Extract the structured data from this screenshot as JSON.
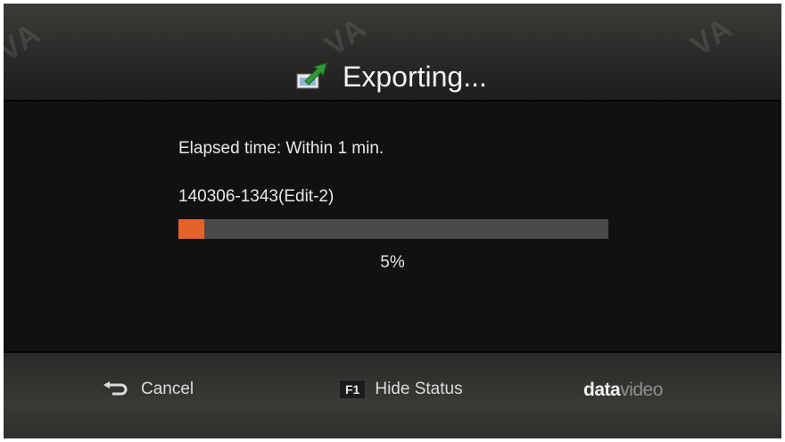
{
  "header": {
    "title": "Exporting...",
    "icon": "export-icon",
    "watermark": "VA"
  },
  "status": {
    "elapsed": "Elapsed time: Within 1 min.",
    "filename": "140306-1343(Edit-2)",
    "progress_percent_label": "5%",
    "progress_value": 0.05,
    "progress_color": "#e6612a",
    "track_color": "#4a4a48"
  },
  "footer": {
    "cancel": {
      "icon": "return-icon",
      "label": "Cancel"
    },
    "hide_status": {
      "key": "F1",
      "label": "Hide Status"
    },
    "logo_bold": "data",
    "logo_light": "video"
  }
}
